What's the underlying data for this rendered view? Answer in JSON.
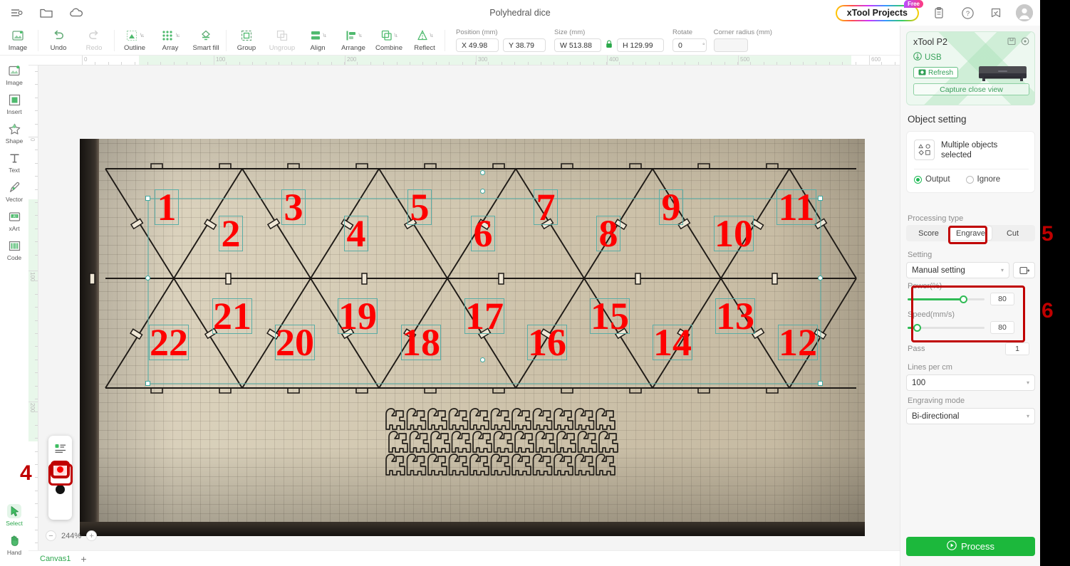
{
  "titlebar": {
    "title": "Polyhedral dice",
    "left_icons": [
      "menu-list-icon",
      "folder-icon",
      "cloud-icon"
    ],
    "projects_button": "xTool Projects",
    "projects_badge": "Free",
    "right_icons": [
      "clipboard-icon",
      "help-icon",
      "store-icon",
      "avatar-icon"
    ]
  },
  "toolbar": {
    "items": [
      {
        "label": "Image",
        "icon": "image-icon",
        "caret": false,
        "disabled": false
      },
      {
        "label": "Undo",
        "icon": "undo-icon",
        "caret": false,
        "disabled": false
      },
      {
        "label": "Redo",
        "icon": "redo-icon",
        "caret": false,
        "disabled": true
      },
      {
        "label": "Outline",
        "icon": "outline-icon",
        "caret": true,
        "disabled": false
      },
      {
        "label": "Array",
        "icon": "array-icon",
        "caret": true,
        "disabled": false
      },
      {
        "label": "Smart fill",
        "icon": "smart-fill-icon",
        "caret": false,
        "disabled": false
      },
      {
        "label": "Group",
        "icon": "group-icon",
        "caret": false,
        "disabled": false
      },
      {
        "label": "Ungroup",
        "icon": "ungroup-icon",
        "caret": false,
        "disabled": true
      },
      {
        "label": "Align",
        "icon": "align-icon",
        "caret": true,
        "disabled": false
      },
      {
        "label": "Arrange",
        "icon": "arrange-icon",
        "caret": true,
        "disabled": false
      },
      {
        "label": "Combine",
        "icon": "combine-icon",
        "caret": true,
        "disabled": false
      },
      {
        "label": "Reflect",
        "icon": "reflect-icon",
        "caret": true,
        "disabled": false
      }
    ],
    "position_label": "Position (mm)",
    "pos_x": "X 49.98",
    "pos_y": "Y 38.79",
    "size_label": "Size (mm)",
    "size_w": "W 513.88",
    "size_h": "H 129.99",
    "lock_icon": "lock-icon",
    "rotate_label": "Rotate",
    "rotate_value": "0",
    "rotate_unit": "°",
    "corner_label": "Corner radius (mm)",
    "corner_value": ""
  },
  "rail": {
    "items": [
      {
        "label": "Image",
        "icon": "image-tool-icon"
      },
      {
        "label": "Insert",
        "icon": "insert-tool-icon"
      },
      {
        "label": "Shape",
        "icon": "shape-tool-icon"
      },
      {
        "label": "Text",
        "icon": "text-tool-icon"
      },
      {
        "label": "Vector",
        "icon": "vector-tool-icon"
      },
      {
        "label": "xArt",
        "icon": "xart-tool-icon"
      },
      {
        "label": "Code",
        "icon": "code-tool-icon"
      }
    ],
    "bottom": [
      {
        "label": "Select",
        "icon": "cursor-icon",
        "selected": true
      },
      {
        "label": "Hand",
        "icon": "hand-icon",
        "selected": false
      }
    ]
  },
  "canvas": {
    "ruler_h_labels": [
      "0",
      "100",
      "200",
      "300",
      "400",
      "500",
      "600"
    ],
    "ruler_v_labels": [
      "0",
      "100",
      "200"
    ],
    "zoom_level": "244%",
    "zoom_out": "−",
    "zoom_in": "+",
    "tab_name": "Canvas1",
    "tab_add": "+",
    "net_numbers_top": [
      "1",
      "2",
      "3",
      "4",
      "5",
      "6",
      "7",
      "8",
      "9",
      "10",
      "11"
    ],
    "net_numbers_bottom": [
      "22",
      "21",
      "20",
      "19",
      "18",
      "17",
      "16",
      "15",
      "14",
      "13",
      "12"
    ]
  },
  "palette": {
    "list_icon": "layers-list-icon",
    "selected_swatch_color": "#ff0000",
    "swatches": [
      {
        "name": "red-swatch",
        "color": "#ff0000",
        "selected": true
      },
      {
        "name": "black-swatch",
        "color": "#111111",
        "selected": false
      }
    ]
  },
  "panel": {
    "device": {
      "name": "xTool P2",
      "connection": "USB",
      "connection_icon": "usb-icon",
      "refresh_label": "Refresh",
      "refresh_icon": "refresh-camera-icon",
      "capture_label": "Capture close view",
      "corner_icons": [
        "framing-icon",
        "target-icon"
      ]
    },
    "object_setting_title": "Object setting",
    "object_selected_label": "Multiple objects selected",
    "object_thumb_icon": "shapes-icon",
    "output_label": "Output",
    "ignore_label": "Ignore",
    "output_selected": true,
    "processing_type_label": "Processing type",
    "processing_types": [
      "Score",
      "Engrave",
      "Cut"
    ],
    "processing_type_active": "Engrave",
    "setting_label": "Setting",
    "setting_value": "Manual setting",
    "setting_extra_icon": "save-preset-icon",
    "power_label": "Power(%)",
    "power_value": "80",
    "power_pct": 72,
    "speed_label": "Speed(mm/s)",
    "speed_value": "80",
    "speed_pct": 12,
    "pass_label": "Pass",
    "pass_value": "1",
    "lines_label": "Lines per cm",
    "lines_value": "100",
    "mode_label": "Engraving mode",
    "mode_value": "Bi-directional",
    "process_label": "Process",
    "process_icon": "play-icon"
  },
  "annotations": [
    {
      "name": "annotation-4",
      "text": "4"
    },
    {
      "name": "annotation-5",
      "text": "5"
    },
    {
      "name": "annotation-6",
      "text": "6"
    }
  ],
  "colors": {
    "accent_green": "#1cb83c",
    "highlight_red": "#c00000",
    "overlay_red": "#ff0000",
    "selection_teal": "#5aada6"
  }
}
